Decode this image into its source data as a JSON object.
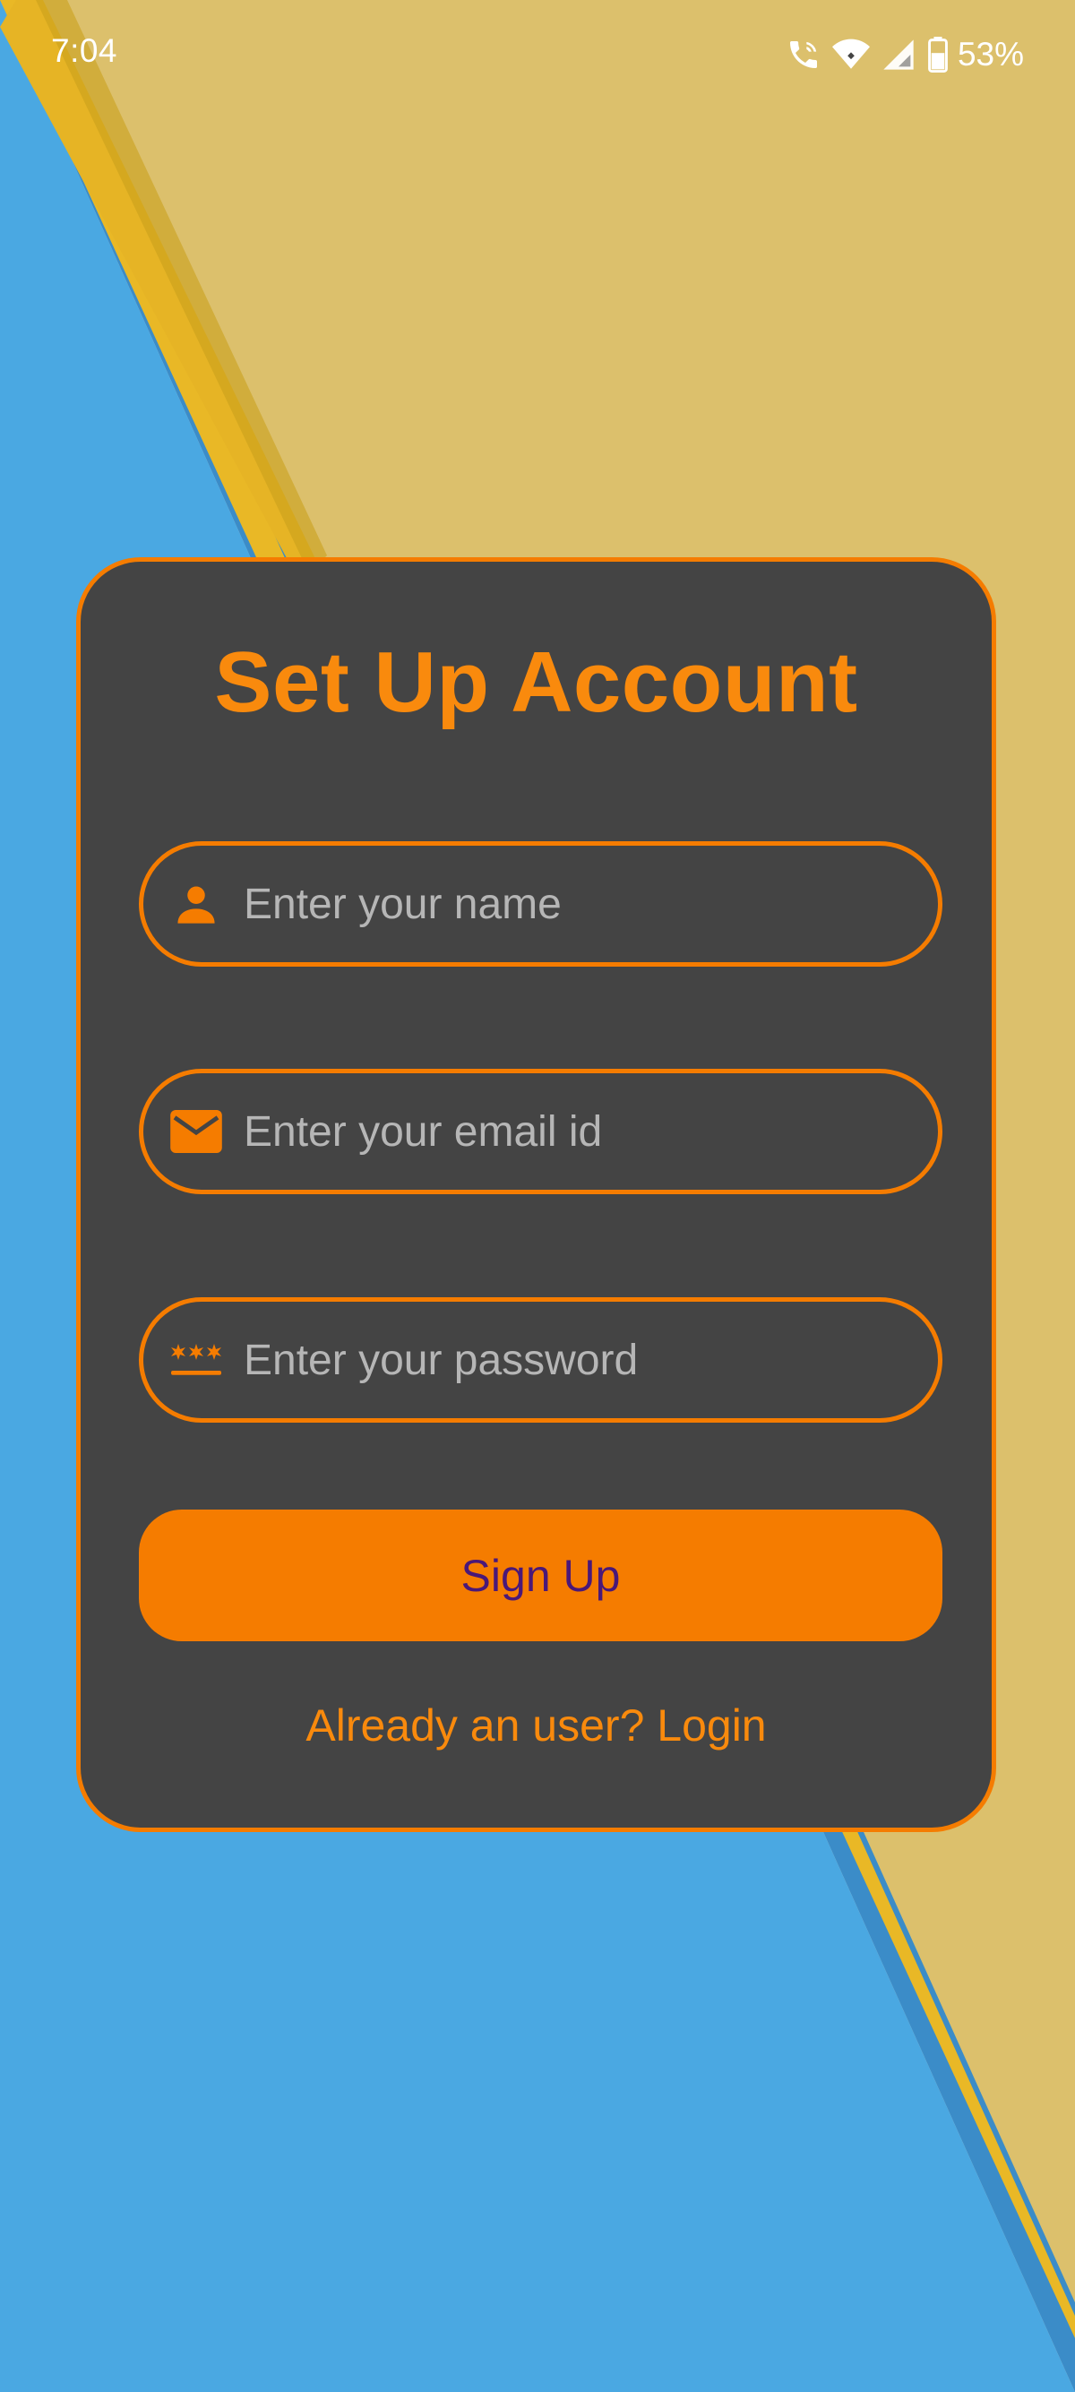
{
  "status_bar": {
    "time": "7:04",
    "battery": "53%",
    "icons": [
      "wifi-calling-icon",
      "wifi-icon",
      "signal-icon",
      "battery-icon"
    ]
  },
  "form": {
    "title": "Set Up Account",
    "fields": [
      {
        "icon": "person-icon",
        "placeholder": "Enter your name",
        "value": ""
      },
      {
        "icon": "email-icon",
        "placeholder": "Enter your email id",
        "value": ""
      },
      {
        "icon": "password-icon",
        "placeholder": "Enter your password",
        "value": ""
      }
    ],
    "submit_label": "Sign Up",
    "login_prompt": "Already an user? Login"
  },
  "colors": {
    "accent": "#f57c00",
    "card_background": "#444444",
    "button_text": "#4a1878",
    "background_yellow": "#dcc06c",
    "background_blue": "#4aa8e2"
  }
}
